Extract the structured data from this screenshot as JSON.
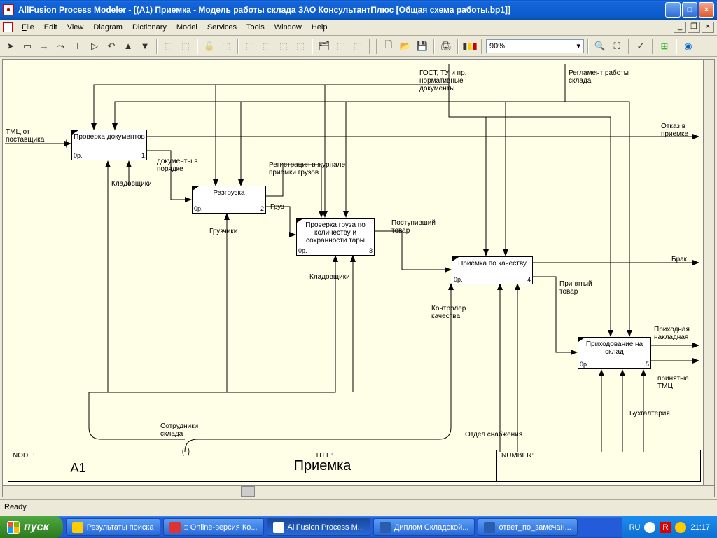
{
  "titlebar": "AllFusion Process Modeler  - [(A1) Приемка - Модель работы склада ЗАО КонсультантПлюс  [Общая схема работы.bp1]]",
  "menu": {
    "file": "File",
    "edit": "Edit",
    "view": "View",
    "diagram": "Diagram",
    "dictionary": "Dictionary",
    "model": "Model",
    "services": "Services",
    "tools": "Tools",
    "window": "Window",
    "help": "Help"
  },
  "zoom": "90%",
  "status": "Ready",
  "footer": {
    "node_lbl": "NODE:",
    "node_val": "A1",
    "title_lbl": "TITLE:",
    "title_val": "Приемка",
    "num_lbl": "NUMBER:"
  },
  "boxes": {
    "b1": {
      "t": "Проверка документов",
      "op": "0р.",
      "n": "1"
    },
    "b2": {
      "t": "Разгрузка",
      "op": "0р.",
      "n": "2"
    },
    "b3": {
      "t": "Проверка груза по количеству и сохранности тары",
      "op": "0р.",
      "n": "3"
    },
    "b4": {
      "t": "Приемка по качеству",
      "op": "0р.",
      "n": "4"
    },
    "b5": {
      "t": "Приходование на склад",
      "op": "0р.",
      "n": "5"
    }
  },
  "labels": {
    "l_tmc": "ТМЦ от поставщика",
    "l_gost": "ГОСТ, ТУ и пр. нормативные документы",
    "l_regl": "Регламент работы склада",
    "l_otkaz": "Отказ в приемке",
    "l_docok": "документы в порядке",
    "l_klad1": "Кладовщики",
    "l_regj": "Регистрация в журнале приемки грузов",
    "l_gruz": "Груз",
    "l_gruzch": "Грузчики",
    "l_post": "Поступивший товар",
    "l_klad2": "Кладовщики",
    "l_brak": "Брак",
    "l_prin": "Принятый товар",
    "l_kontr": "Контролер качества",
    "l_prnakl": "Приходная накладная",
    "l_printmc": "принятые ТМЦ",
    "l_buh": "Бухгалтерия",
    "l_otdel": "Отдел снабжения",
    "l_sotr": "Сотрудники склада"
  },
  "taskbar": {
    "start": "пуск",
    "t1": "Результаты поиска",
    "t2": ":: Online-версия Ко...",
    "t3": "AllFusion Process M...",
    "t4": "Диплом Складской...",
    "t5": "ответ_по_замечан...",
    "lang": "RU",
    "clock": "21:17"
  }
}
